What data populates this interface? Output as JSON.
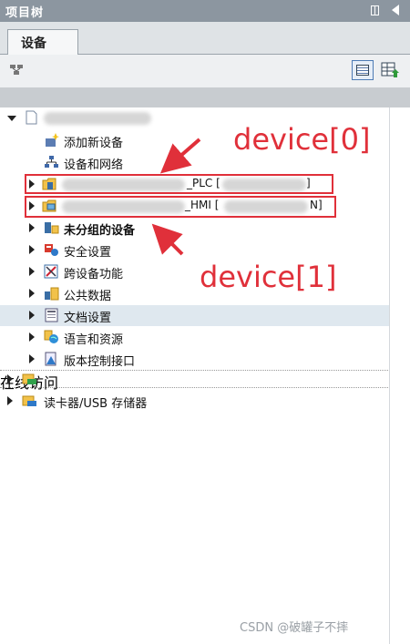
{
  "panel": {
    "title": "项目树"
  },
  "tabs": [
    {
      "label": "设备"
    }
  ],
  "tree": {
    "items": [
      {
        "label": "添加新设备"
      },
      {
        "label": "设备和网络"
      },
      {
        "label_suffix": "_PLC [",
        "label_end": "]"
      },
      {
        "label_suffix": "_HMI [",
        "label_end": "N]"
      },
      {
        "label": "未分组的设备"
      },
      {
        "label": "安全设置"
      },
      {
        "label": "跨设备功能"
      },
      {
        "label": "公共数据"
      },
      {
        "label": "文档设置"
      },
      {
        "label": "语言和资源"
      },
      {
        "label": "版本控制接口"
      },
      {
        "label": "在线访问"
      },
      {
        "label": "读卡器/USB 存储器"
      }
    ]
  },
  "annotations": {
    "device0": "device[0]",
    "device1": "device[1]",
    "color": "#e0303a"
  },
  "watermark": "CSDN @破罐子不摔",
  "colors": {
    "titlebar": "#8c96a0",
    "highlight_row": "#dfe8ef",
    "tab_bg": "#f6f7f8"
  }
}
